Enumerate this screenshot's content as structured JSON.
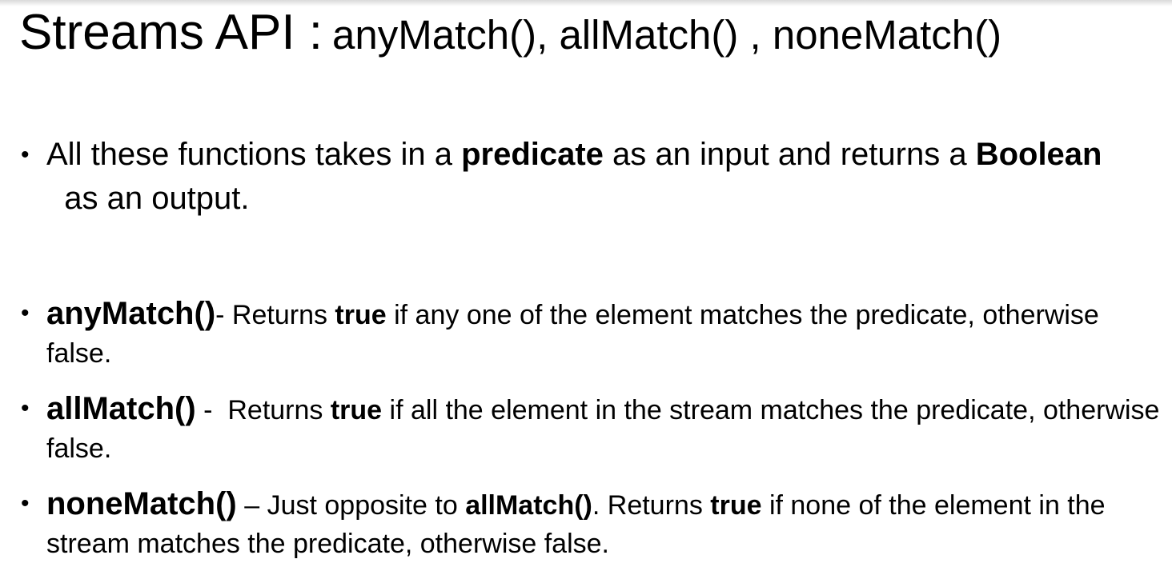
{
  "title": {
    "main": "Streams API :",
    "sub": "anyMatch(), allMatch() , noneMatch()"
  },
  "bullet_glyph": "•",
  "bullets": [
    {
      "text_1": "All these functions takes in a ",
      "bold_1": "predicate",
      "text_2": " as an input and returns a ",
      "bold_2": "Boolean",
      "text_3": "  as an output."
    },
    {
      "term": "anyMatch()",
      "sep": "- ",
      "text_1": "Returns ",
      "bold_1": "true",
      "text_2": " if any one of the element matches the predicate, otherwise false."
    },
    {
      "term": "allMatch()",
      "sep": " -  ",
      "text_1": "Returns ",
      "bold_1": "true",
      "text_2": " if all the element in the stream matches the predicate, otherwise false."
    },
    {
      "term": "noneMatch()",
      "sep": " – ",
      "text_1": "Just opposite to ",
      "bold_1": "allMatch()",
      "text_2": ". Returns ",
      "bold_2": "true",
      "text_3": " if none of the element in the stream matches the predicate, otherwise false."
    }
  ]
}
